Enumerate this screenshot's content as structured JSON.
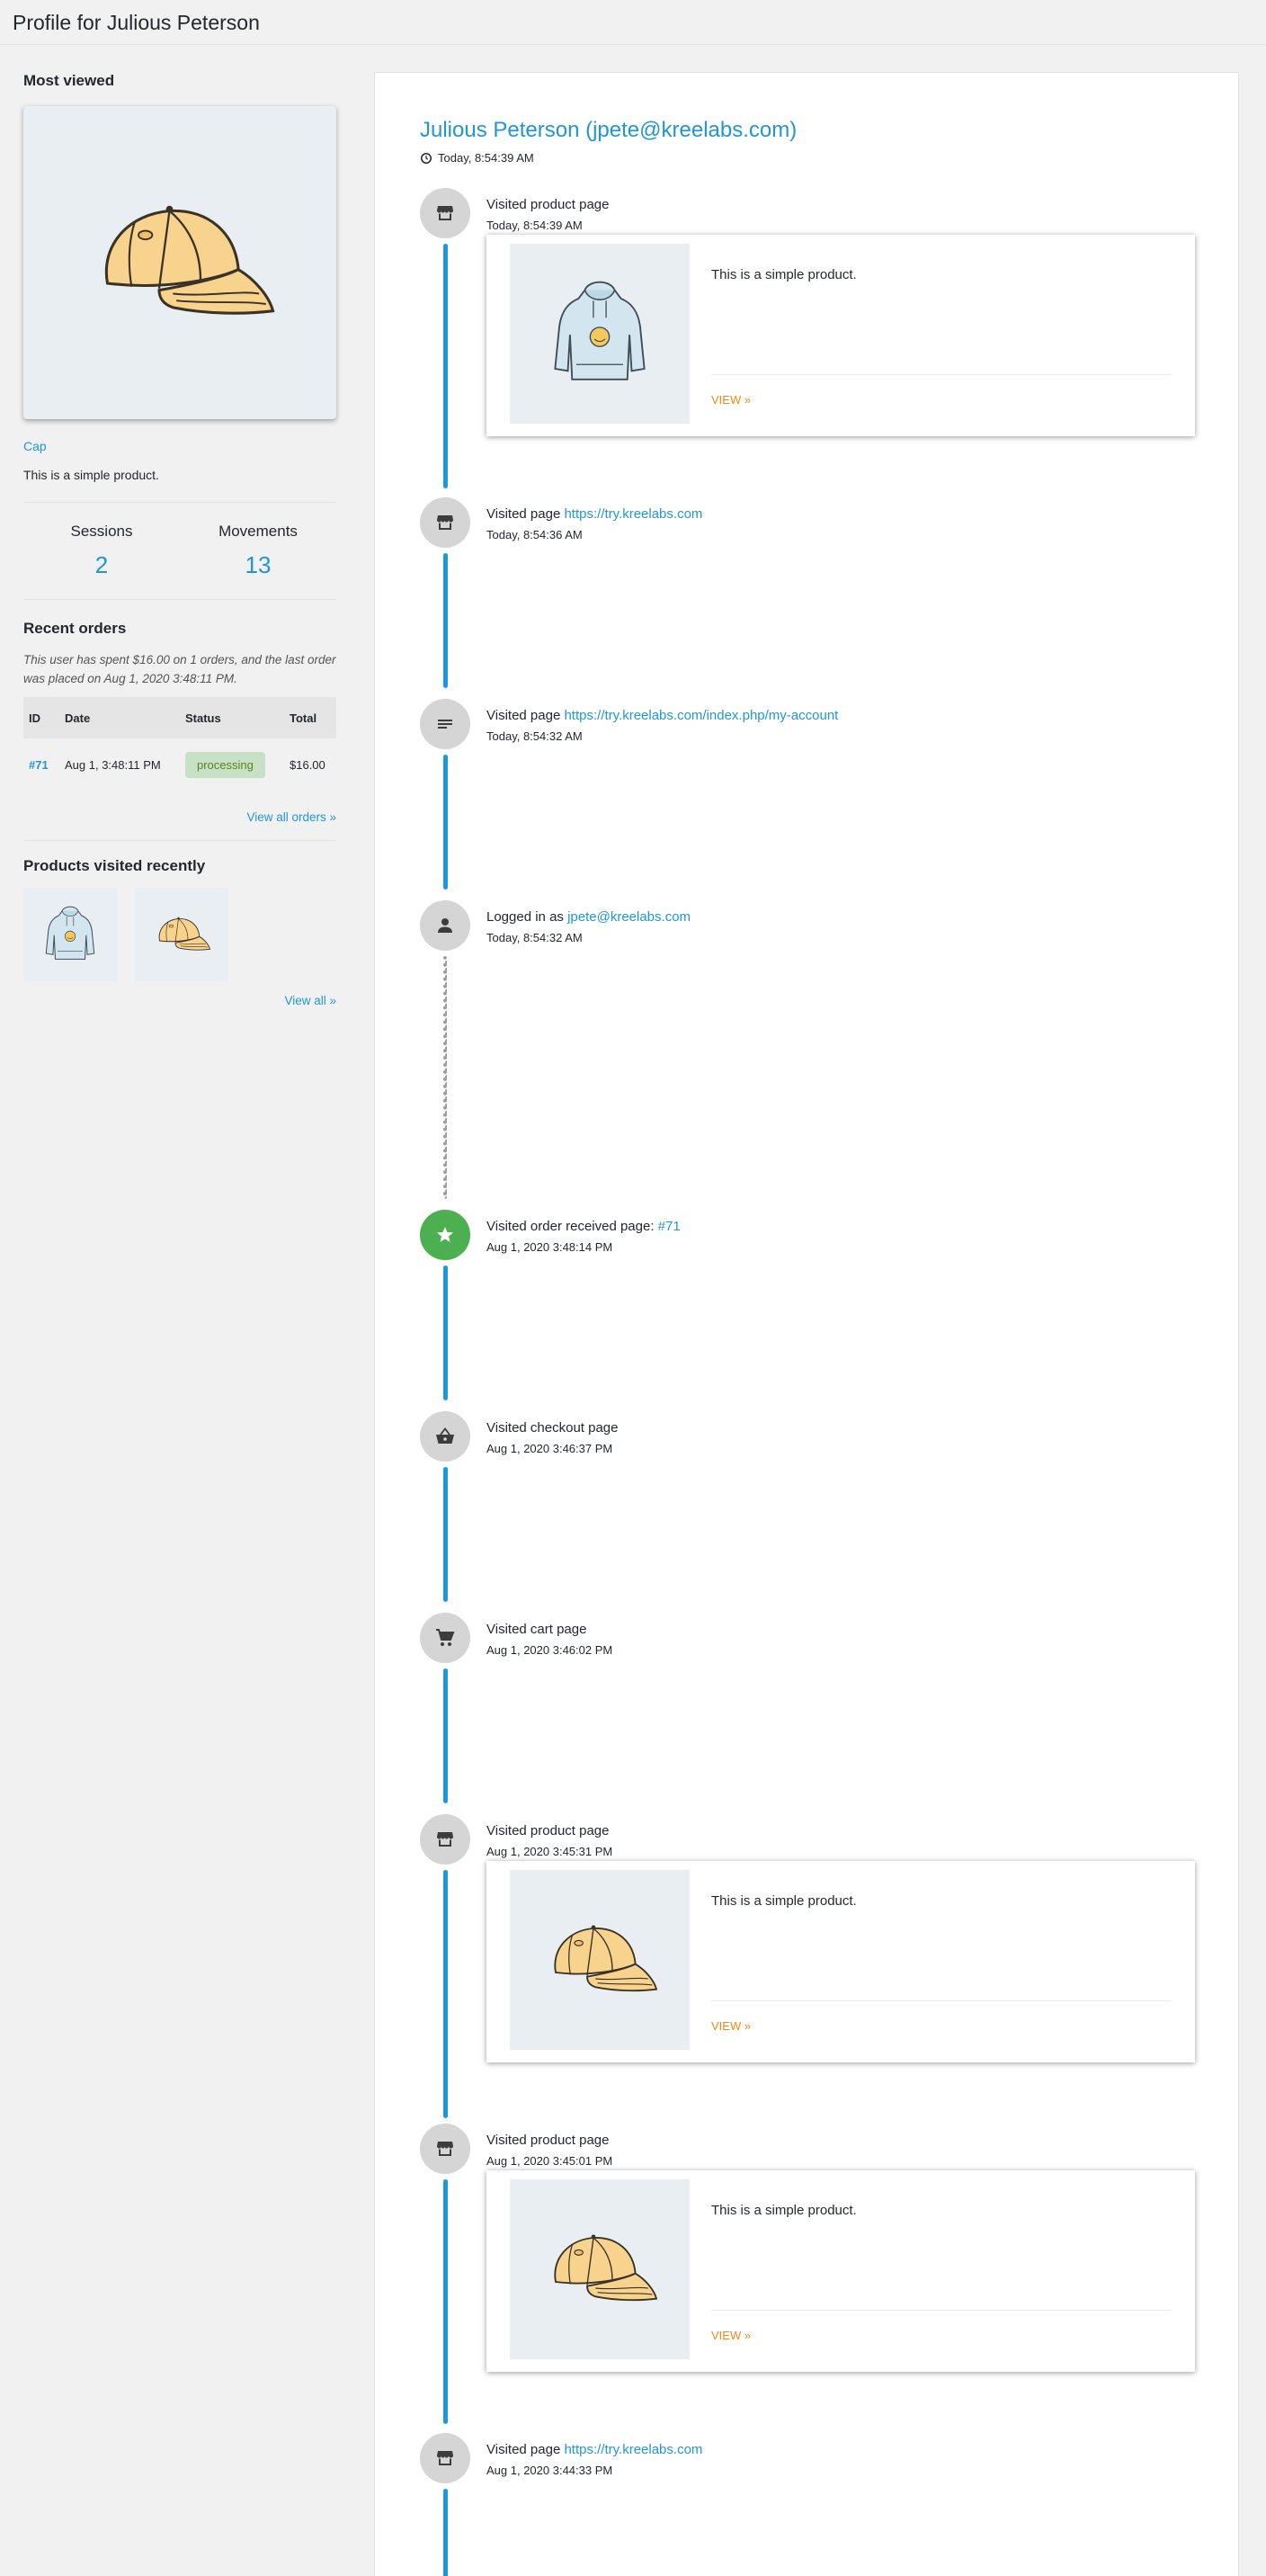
{
  "page": {
    "title": "Profile for Julious Peterson"
  },
  "sidebar": {
    "most_viewed": {
      "title": "Most viewed",
      "product_name": "Cap",
      "product_description": "This is a simple product."
    },
    "stats": {
      "sessions_label": "Sessions",
      "sessions_value": "2",
      "movements_label": "Movements",
      "movements_value": "13"
    },
    "recent_orders": {
      "title": "Recent orders",
      "summary": "This user has spent $16.00 on 1 orders, and the last order was placed on Aug 1, 2020 3:48:11 PM.",
      "columns": [
        "ID",
        "Date",
        "Status",
        "Total"
      ],
      "rows": [
        {
          "id": "#71",
          "date": "Aug 1, 3:48:11 PM",
          "status": "processing",
          "total": "$16.00"
        }
      ],
      "view_all": "View all orders »"
    },
    "products_visited": {
      "title": "Products visited recently",
      "items": [
        "hoodie",
        "cap"
      ],
      "view_all": "View all »"
    }
  },
  "main": {
    "customer_heading": "Julious Peterson (jpete@kreelabs.com)",
    "customer_time": "Today, 8:54:39 AM",
    "events": [
      {
        "icon": "storefront-icon",
        "title": "Visited product page",
        "link": "",
        "time": "Today, 8:54:39 AM",
        "card": {
          "image": "hoodie",
          "description": "This is a simple product.",
          "view_label": "VIEW »"
        }
      },
      {
        "icon": "storefront-icon",
        "title": "Visited page ",
        "link": "https://try.kreelabs.com",
        "time": "Today, 8:54:36 AM"
      },
      {
        "icon": "text-lines-icon",
        "title": "Visited page ",
        "link": "https://try.kreelabs.com/index.php/my-account",
        "time": "Today, 8:54:32 AM"
      },
      {
        "icon": "person-icon",
        "title": "Logged in as ",
        "link": "jpete@kreelabs.com",
        "time": "Today, 8:54:32 AM"
      },
      {
        "icon": "star-icon",
        "title": "Visited order received page: ",
        "link": "#71",
        "time": "Aug 1, 2020 3:48:14 PM"
      },
      {
        "icon": "basket-icon",
        "title": "Visited checkout page",
        "link": "",
        "time": "Aug 1, 2020 3:46:37 PM"
      },
      {
        "icon": "cart-icon",
        "title": "Visited cart page",
        "link": "",
        "time": "Aug 1, 2020 3:46:02 PM"
      },
      {
        "icon": "storefront-icon",
        "title": "Visited product page",
        "link": "",
        "time": "Aug 1, 2020 3:45:31 PM",
        "card": {
          "image": "cap",
          "description": "This is a simple product.",
          "view_label": "VIEW »"
        }
      },
      {
        "icon": "storefront-icon",
        "title": "Visited product page",
        "link": "",
        "time": "Aug 1, 2020 3:45:01 PM",
        "card": {
          "image": "cap",
          "description": "This is a simple product.",
          "view_label": "VIEW »"
        }
      },
      {
        "icon": "storefront-icon",
        "title": "Visited page ",
        "link": "https://try.kreelabs.com",
        "time": "Aug 1, 2020 3:44:33 PM"
      }
    ]
  },
  "colors": {
    "accent": "#1e96e0",
    "link": "#2196d6",
    "view_link": "#f0871a",
    "status_bg": "#c6e1c6",
    "status_text": "#5b841b",
    "event_green": "#4caf50"
  }
}
